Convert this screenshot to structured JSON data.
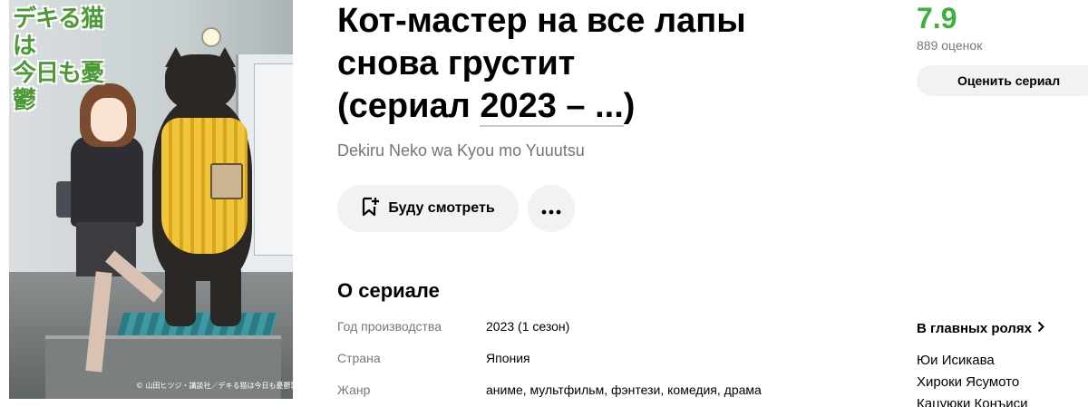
{
  "poster": {
    "logo_line1": "デキる猫は",
    "logo_line2": "今日も憂鬱",
    "copyright": "© 山田ヒツジ・講談社／デキる猫は今日も憂鬱製作委員会"
  },
  "title": {
    "main_line1": "Кот-мастер на все лапы",
    "main_line2": "снова грустит",
    "main_prefix": "(сериал ",
    "years": "2023 – ...",
    "main_suffix": ")",
    "original": "Dekiru Neko wa Kyou mo Yuuutsu"
  },
  "actions": {
    "watch_label": "Буду смотреть",
    "more_label": "•••"
  },
  "rating": {
    "value": "7.9",
    "votes": "889 оценок",
    "rate_label": "Оценить сериал",
    "accent_color": "#3bb33b"
  },
  "about": {
    "heading": "О сериале",
    "rows": [
      {
        "key": "Год производства",
        "value": "2023 (1 сезон)"
      },
      {
        "key": "Страна",
        "value": "Япония"
      },
      {
        "key": "Жанр",
        "value": "аниме, мультфильм, фэнтези, комедия, драма"
      }
    ]
  },
  "cast": {
    "heading": "В главных ролях",
    "items": [
      "Юи Исикава",
      "Хироки Ясумото",
      "Кацуюки Конъиси"
    ]
  },
  "icons": {
    "watch": "bookmark-plus-icon",
    "more": "more-dots-icon",
    "cast_chevron": "chevron-right-icon"
  }
}
